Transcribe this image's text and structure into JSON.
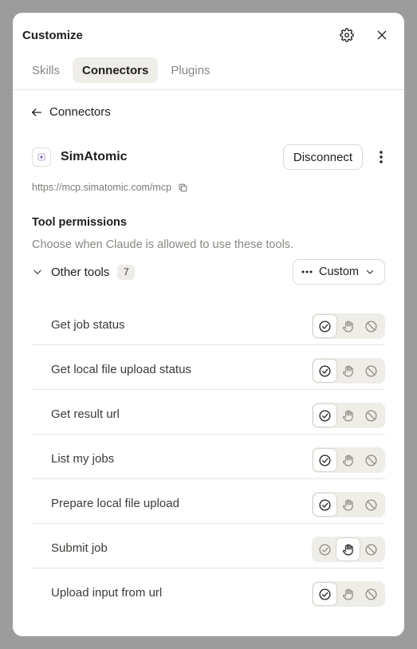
{
  "header": {
    "title": "Customize",
    "settings_icon": "gear-icon",
    "close_icon": "close-icon"
  },
  "tabs": [
    {
      "label": "Skills",
      "active": false
    },
    {
      "label": "Connectors",
      "active": true
    },
    {
      "label": "Plugins",
      "active": false
    }
  ],
  "back": {
    "label": "Connectors",
    "icon": "arrow-left-icon"
  },
  "connector": {
    "name": "SimAtomic",
    "disconnect_label": "Disconnect",
    "url": "https://mcp.simatomic.com/mcp",
    "copy_icon": "copy-icon"
  },
  "permissions": {
    "title": "Tool permissions",
    "description": "Choose when Claude is allowed to use these tools.",
    "group": {
      "label": "Other tools",
      "count": "7",
      "mode": "Custom"
    },
    "tools": [
      {
        "name": "Get job status",
        "permission": "allow"
      },
      {
        "name": "Get local file upload status",
        "permission": "allow"
      },
      {
        "name": "Get result url",
        "permission": "allow"
      },
      {
        "name": "List my jobs",
        "permission": "allow"
      },
      {
        "name": "Prepare local file upload",
        "permission": "allow"
      },
      {
        "name": "Submit job",
        "permission": "ask"
      },
      {
        "name": "Upload input from url",
        "permission": "allow"
      }
    ]
  },
  "colors": {
    "accent_muted": "#efede8",
    "text": "#1f1e1d",
    "muted_text": "#8a8883",
    "overlay": "#9c9c9c"
  }
}
